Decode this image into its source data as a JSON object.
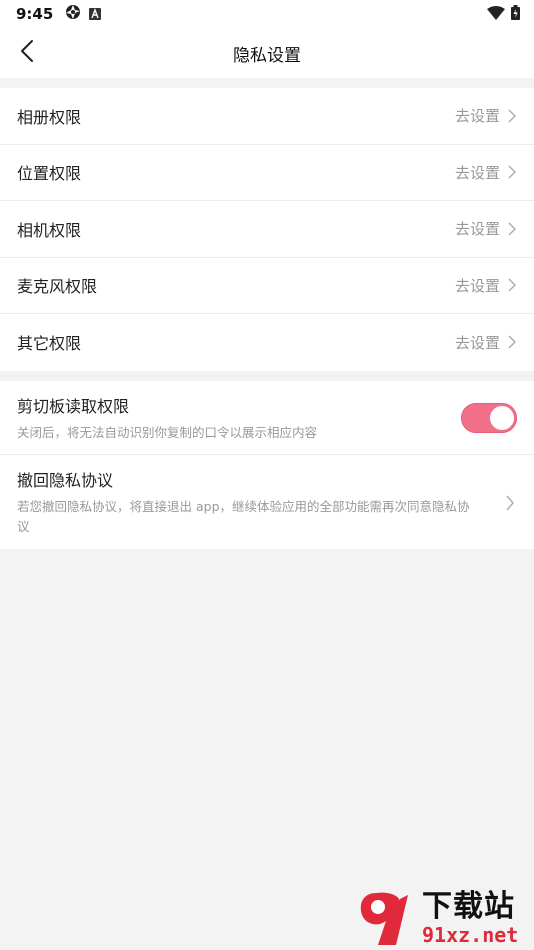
{
  "status_bar": {
    "time": "9:45"
  },
  "header": {
    "title": "隐私设置"
  },
  "permissions": [
    {
      "label": "相册权限",
      "action": "去设置"
    },
    {
      "label": "位置权限",
      "action": "去设置"
    },
    {
      "label": "相机权限",
      "action": "去设置"
    },
    {
      "label": "麦克风权限",
      "action": "去设置"
    },
    {
      "label": "其它权限",
      "action": "去设置"
    }
  ],
  "clipboard": {
    "title": "剪切板读取权限",
    "description": "关闭后，将无法自动识别你复制的口令以展示相应内容",
    "enabled": true
  },
  "revoke": {
    "title": "撤回隐私协议",
    "description": "若您撤回隐私协议，将直接退出 app，继续体验应用的全部功能需再次同意隐私协议"
  },
  "watermark": {
    "text": "下载站",
    "url": "91xz.net"
  },
  "colors": {
    "accent": "#f0708a",
    "background": "#f3f3f3",
    "secondary_text": "#999999"
  }
}
